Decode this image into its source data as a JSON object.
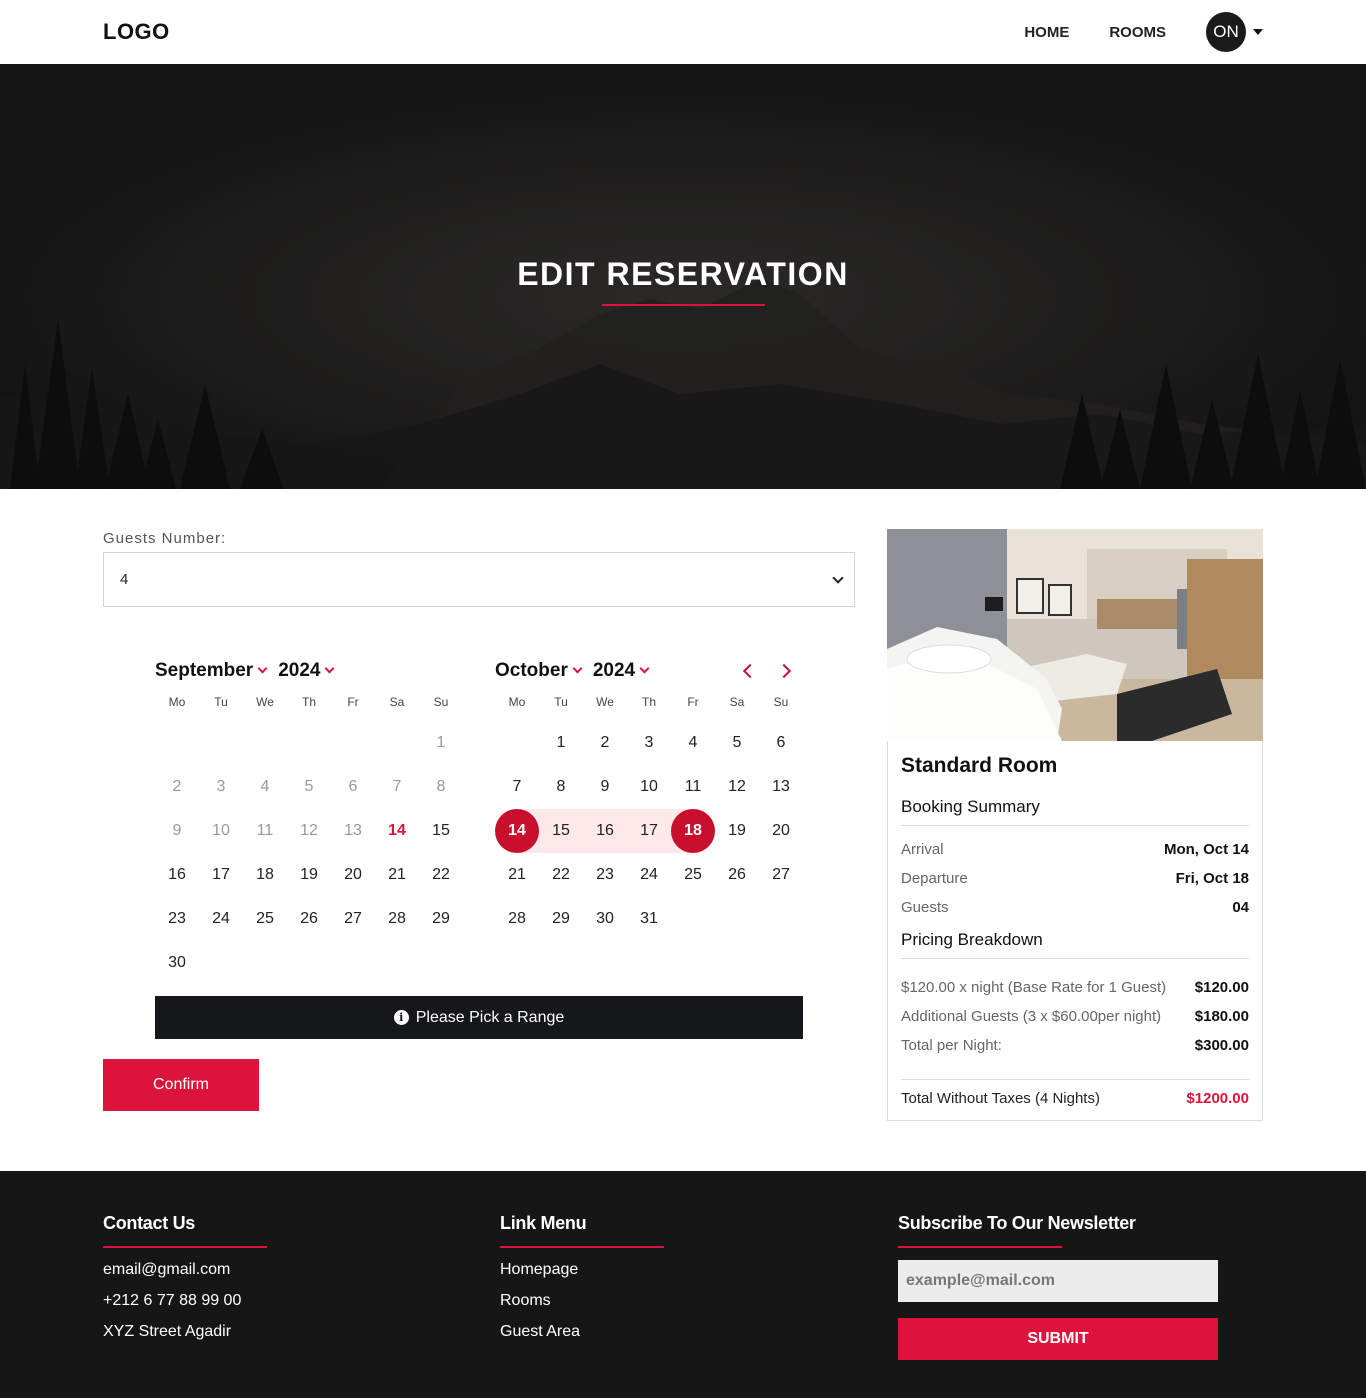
{
  "header": {
    "logo": "LOGO",
    "nav": [
      "HOME",
      "ROOMS"
    ],
    "avatar": "ON"
  },
  "hero": {
    "title": "EDIT RESERVATION"
  },
  "form": {
    "guests_label": "Guests Number:",
    "guests_value": "4"
  },
  "calendar": {
    "weekdays": [
      "Mo",
      "Tu",
      "We",
      "Th",
      "Fr",
      "Sa",
      "Su"
    ],
    "left": {
      "month": "September",
      "year": "2024"
    },
    "right": {
      "month": "October",
      "year": "2024"
    },
    "range_message": "Please Pick a Range",
    "confirm": "Confirm"
  },
  "summary": {
    "room": "Standard Room",
    "booking_title": "Booking Summary",
    "arrival_label": "Arrival",
    "arrival": "Mon, Oct 14",
    "departure_label": "Departure",
    "departure": "Fri, Oct 18",
    "guests_label": "Guests",
    "guests": "04",
    "pricing_title": "Pricing Breakdown",
    "base_label": "$120.00 x night (Base Rate for 1 Guest)",
    "base": "$120.00",
    "additional_label": "Additional Guests (3 x $60.00per night)",
    "additional": "$180.00",
    "per_night_label": "Total per Night:",
    "per_night": "$300.00",
    "total_label": "Total Without Taxes (4 Nights)",
    "total": "$1200.00"
  },
  "footer": {
    "contact_title": "Contact Us",
    "contact": [
      "email@gmail.com",
      "+212 6 77 88 99 00",
      "XYZ Street Agadir"
    ],
    "links_title": "Link Menu",
    "links": [
      "Homepage",
      "Rooms",
      "Guest Area"
    ],
    "newsletter_title": "Subscribe To Our Newsletter",
    "newsletter_placeholder": "example@mail.com",
    "submit": "SUBMIT"
  },
  "colors": {
    "accent": "#dc143c",
    "dark": "#161616",
    "range": "#fde8ea"
  }
}
